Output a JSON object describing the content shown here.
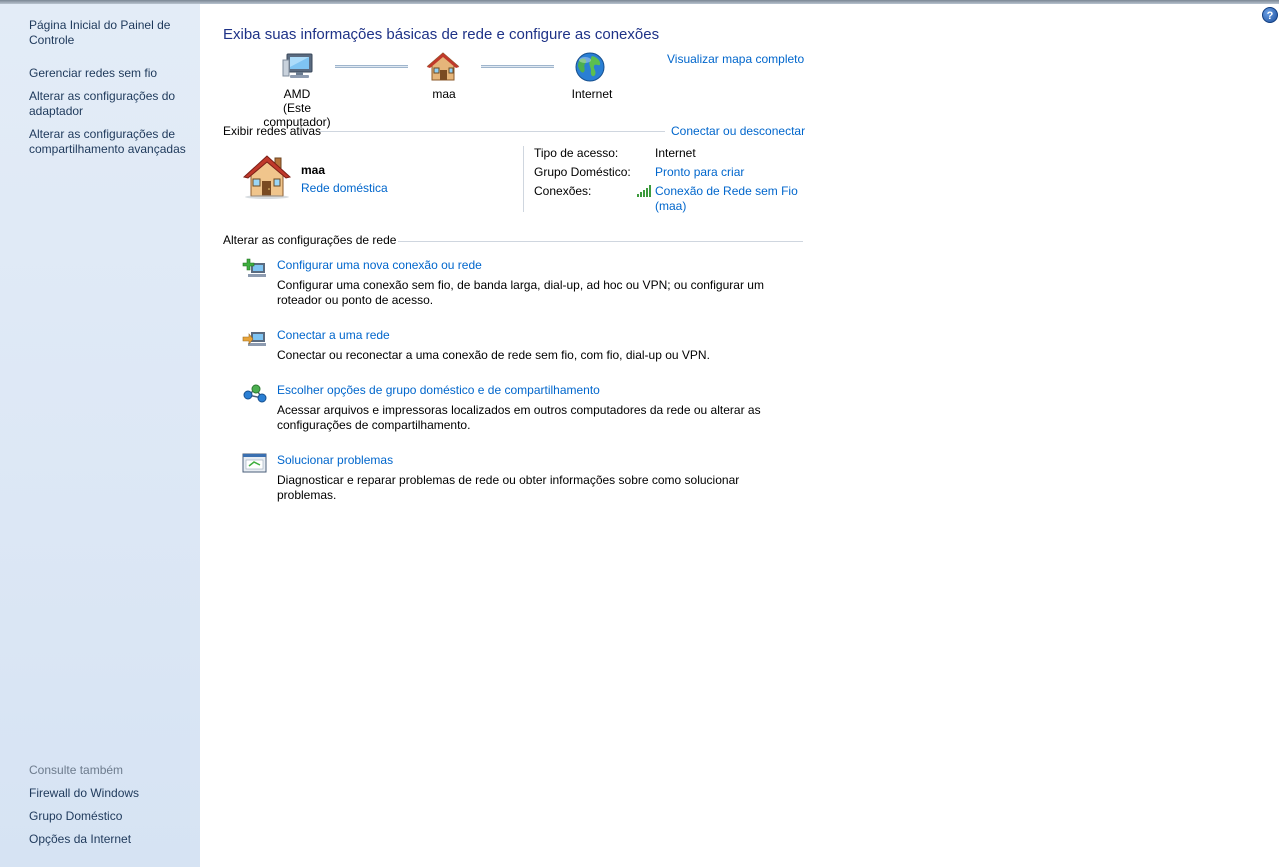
{
  "window": {
    "help_label": "?"
  },
  "sidebar": {
    "items": [
      {
        "label": "Página Inicial do Painel de Controle"
      },
      {
        "label": "Gerenciar redes sem fio"
      },
      {
        "label": "Alterar as configurações do adaptador"
      },
      {
        "label": "Alterar as configurações de compartilhamento avançadas"
      }
    ],
    "see_also": {
      "heading": "Consulte também",
      "items": [
        {
          "label": "Firewall do Windows"
        },
        {
          "label": "Grupo Doméstico"
        },
        {
          "label": "Opções da Internet"
        }
      ]
    }
  },
  "main": {
    "title": "Exiba suas informações básicas de rede e configure as conexões",
    "map": {
      "view_full_map": "Visualizar mapa completo",
      "nodes": [
        {
          "label": "AMD",
          "sublabel": "(Este computador)",
          "icon": "computer-icon"
        },
        {
          "label": "maa",
          "icon": "home-network-icon"
        },
        {
          "label": "Internet",
          "icon": "globe-icon"
        }
      ]
    },
    "active_networks": {
      "heading": "Exibir redes ativas",
      "connect_disconnect": "Conectar ou desconectar",
      "network": {
        "name": "maa",
        "type": "Rede doméstica",
        "icon": "house-icon",
        "access_type_label": "Tipo de acesso:",
        "access_type_value": "Internet",
        "homegroup_label": "Grupo Doméstico:",
        "homegroup_value": "Pronto para criar",
        "connections_label": "Conexões:",
        "connections_value_line1": "Conexão de Rede sem Fio",
        "connections_value_line2": "(maa)",
        "signal_icon": "wireless-signal-icon"
      }
    },
    "change_settings": {
      "heading": "Alterar as configurações de rede",
      "tasks": [
        {
          "title": "Configurar uma nova conexão ou rede",
          "description": "Configurar uma conexão sem fio, de banda larga, dial-up, ad hoc ou VPN; ou configurar um roteador ou ponto de acesso.",
          "icon": "new-connection-icon"
        },
        {
          "title": "Conectar a uma rede",
          "description": "Conectar ou reconectar a uma conexão de rede sem fio, com fio, dial-up ou VPN.",
          "icon": "connect-network-icon"
        },
        {
          "title": "Escolher opções de grupo doméstico e de compartilhamento",
          "description": "Acessar arquivos e impressoras localizados em outros computadores da rede ou alterar as configurações de compartilhamento.",
          "icon": "homegroup-sharing-icon"
        },
        {
          "title": "Solucionar problemas",
          "description": "Diagnosticar e reparar problemas de rede ou obter informações sobre como solucionar problemas.",
          "icon": "troubleshoot-icon"
        }
      ]
    }
  },
  "colors": {
    "title": "#1e3287",
    "link": "#0066cc",
    "sidebar_link": "#1e395b",
    "sidebar_bg": "#dce7f5"
  }
}
